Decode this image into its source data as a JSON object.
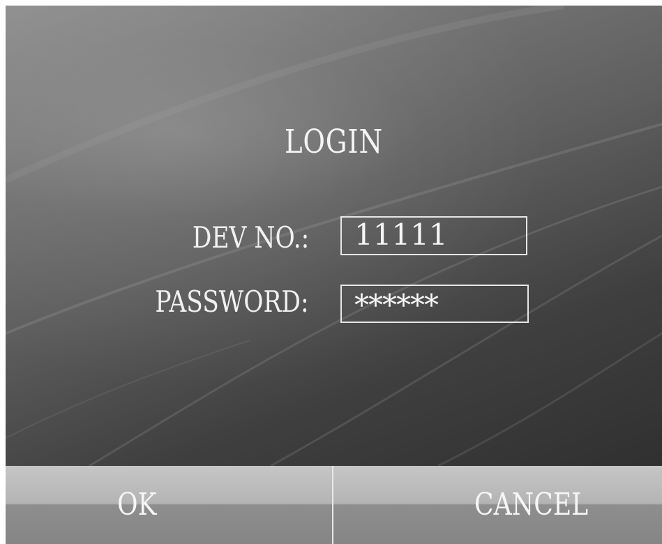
{
  "login": {
    "title": "LOGIN",
    "dev_no_label": "DEV NO.:",
    "dev_no_value": "11111",
    "password_label": "PASSWORD:",
    "password_value": "******"
  },
  "buttons": {
    "ok_label": "OK",
    "cancel_label": "CANCEL"
  },
  "colors": {
    "text": "#f4f4f4",
    "background_dark": "#2a2a2a",
    "background_light": "#8e8e8e",
    "button_gray": "#b4b4b4"
  }
}
